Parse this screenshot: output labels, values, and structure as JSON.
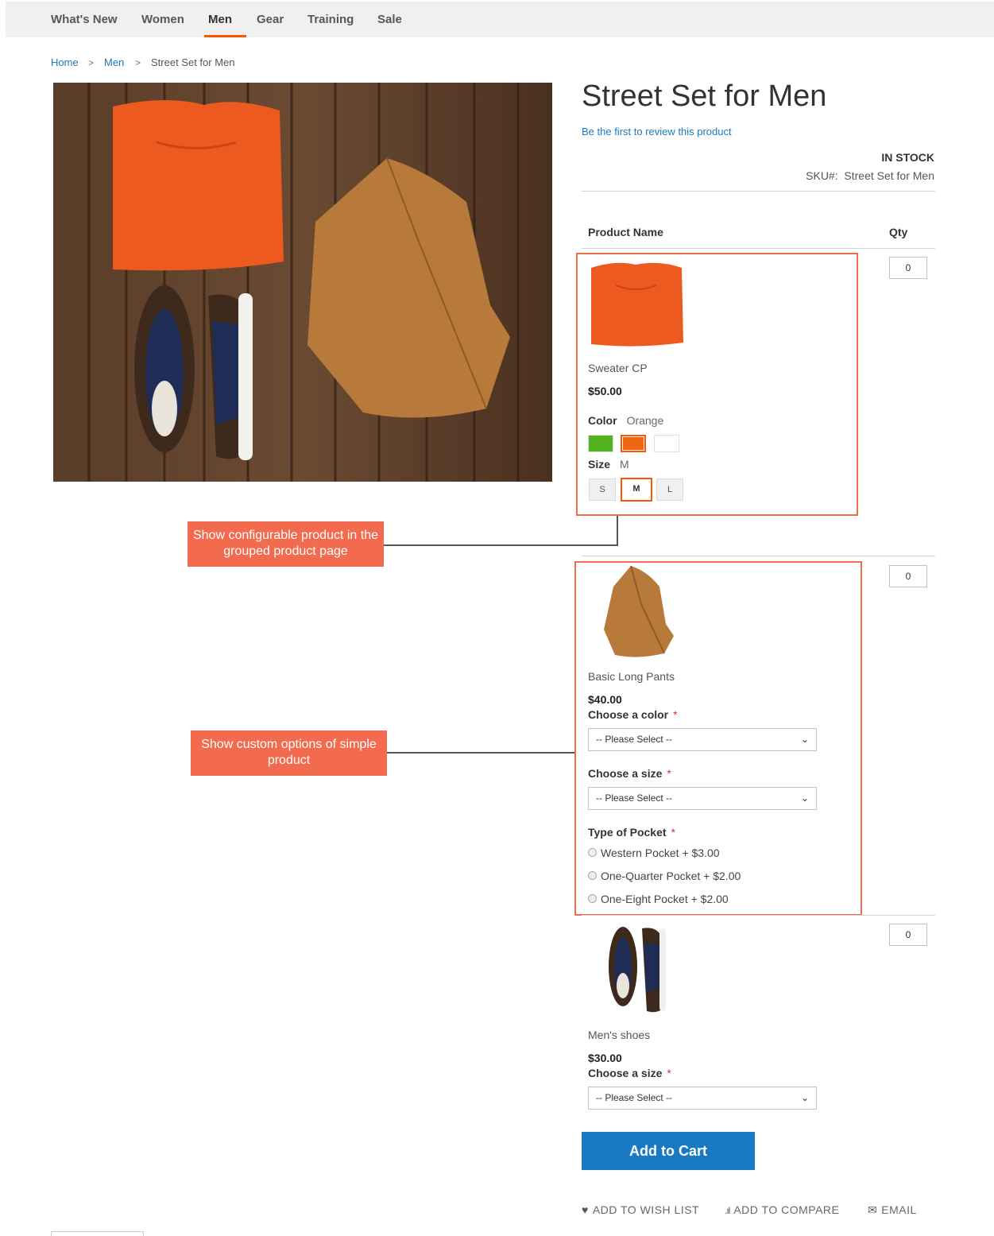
{
  "nav": {
    "items": [
      "What's New",
      "Women",
      "Men",
      "Gear",
      "Training",
      "Sale"
    ],
    "active": "Men"
  },
  "breadcrumb": {
    "home": "Home",
    "category": "Men",
    "current": "Street Set for Men",
    "separator": ">"
  },
  "product": {
    "title": "Street Set for Men",
    "review_link": "Be the first to review this product",
    "stock": "IN STOCK",
    "sku_label": "SKU#:",
    "sku_value": "Street Set for Men"
  },
  "table": {
    "col_name": "Product Name",
    "col_qty": "Qty"
  },
  "items": [
    {
      "name": "Sweater CP",
      "price": "$50.00",
      "qty": "0",
      "color_label": "Color",
      "color_value": "Orange",
      "size_label": "Size",
      "size_value": "M",
      "sizes": [
        "S",
        "M",
        "L"
      ],
      "swatch_colors": [
        "#53b41f",
        "#ee6514",
        "#ffffff"
      ]
    },
    {
      "name": "Basic Long Pants",
      "price": "$40.00",
      "qty": "0",
      "color_label": "Choose a color",
      "size_label": "Choose a size",
      "select_placeholder": "-- Please Select --",
      "pocket_label": "Type of Pocket",
      "pocket_options": [
        "Western Pocket + $3.00",
        "One-Quarter Pocket + $2.00",
        "One-Eight Pocket + $2.00"
      ]
    },
    {
      "name": "Men's shoes",
      "price": "$30.00",
      "qty": "0",
      "size_label": "Choose a size",
      "select_placeholder": "-- Please Select --"
    }
  ],
  "required_mark": "*",
  "callouts": {
    "configurable": "Show configurable product in the grouped product page",
    "custom_options": "Show custom options of simple product"
  },
  "actions": {
    "add_to_cart": "Add to Cart",
    "wishlist": "ADD TO WISH LIST",
    "compare": "ADD TO COMPARE",
    "email": "EMAIL"
  },
  "colors": {
    "accent": "#ff5501",
    "link": "#1979c3",
    "callout": "#f26b4e",
    "button": "#1979c3"
  },
  "icons": [
    "chevron-right-icon",
    "chevron-down-icon",
    "heart-icon",
    "bar-chart-icon",
    "envelope-icon"
  ]
}
